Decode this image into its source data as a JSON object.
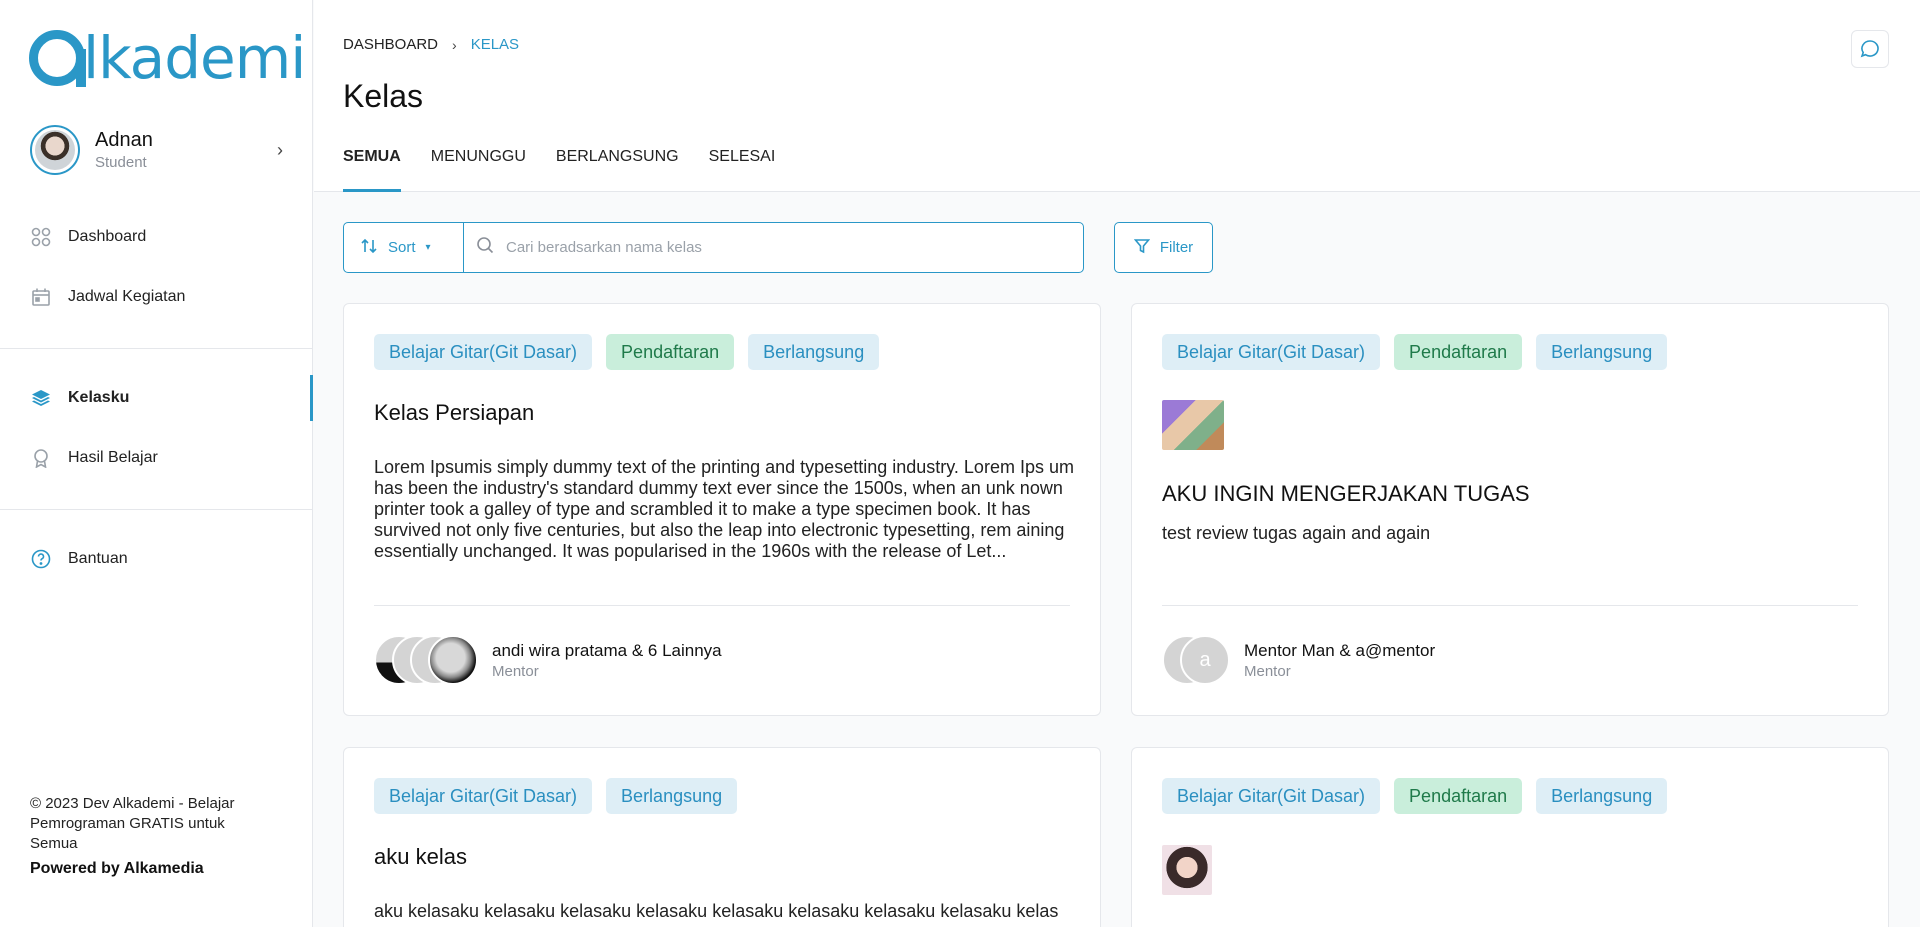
{
  "brand": {
    "logo_text": "lkademi",
    "color": "#2a97c7"
  },
  "user": {
    "name": "Adnan",
    "role": "Student"
  },
  "sidebar": {
    "items": [
      {
        "label": "Dashboard",
        "icon": "dashboard-icon"
      },
      {
        "label": "Jadwal Kegiatan",
        "icon": "calendar-icon"
      },
      {
        "label": "Kelasku",
        "icon": "layers-icon",
        "active": true
      },
      {
        "label": "Hasil Belajar",
        "icon": "award-icon"
      },
      {
        "label": "Bantuan",
        "icon": "help-icon"
      }
    ],
    "footer_text": "© 2023 Dev Alkademi - Belajar Pemrograman GRATIS untuk Semua",
    "powered": "Powered by Alkamedia"
  },
  "breadcrumb": {
    "root": "DASHBOARD",
    "current": "KELAS"
  },
  "page_title": "Kelas",
  "tabs": [
    {
      "label": "SEMUA",
      "active": true
    },
    {
      "label": "MENUNGGU"
    },
    {
      "label": "BERLANGSUNG"
    },
    {
      "label": "SELESAI"
    }
  ],
  "toolbar": {
    "sort_label": "Sort",
    "search_placeholder": "Cari beradsarkan nama kelas",
    "filter_label": "Filter"
  },
  "cards": [
    {
      "tags": [
        "Belajar Gitar(Git Dasar)",
        "Pendaftaran",
        "Berlangsung"
      ],
      "title": "Kelas Persiapan",
      "description": "Lorem Ipsumis simply dummy text of the printing and typesetting industry. Lorem Ips um has been the industry's standard dummy text ever since the 1500s, when an unk nown printer took a galley of type and scrambled it to make a type specimen book. It has survived not only five centuries, but also the leap into electronic typesetting, rem aining essentially unchanged. It was popularised in the 1960s with the release of Let...",
      "mentor_name": "andi wira pratama & 6 Lainnya",
      "mentor_role": "Mentor"
    },
    {
      "tags": [
        "Belajar Gitar(Git Dasar)",
        "Pendaftaran",
        "Berlangsung"
      ],
      "title": "AKU INGIN MENGERJAKAN TUGAS",
      "description": "test review tugas again and again",
      "mentor_name": "Mentor Man & a@mentor",
      "mentor_role": "Mentor",
      "avatar_letter": "a"
    },
    {
      "tags": [
        "Belajar Gitar(Git Dasar)",
        "Berlangsung"
      ],
      "title": "aku kelas",
      "description": "aku kelasaku kelasaku kelasaku kelasaku kelasaku kelasaku kelasaku kelasaku kelas"
    },
    {
      "tags": [
        "Belajar Gitar(Git Dasar)",
        "Pendaftaran",
        "Berlangsung"
      ]
    }
  ]
}
